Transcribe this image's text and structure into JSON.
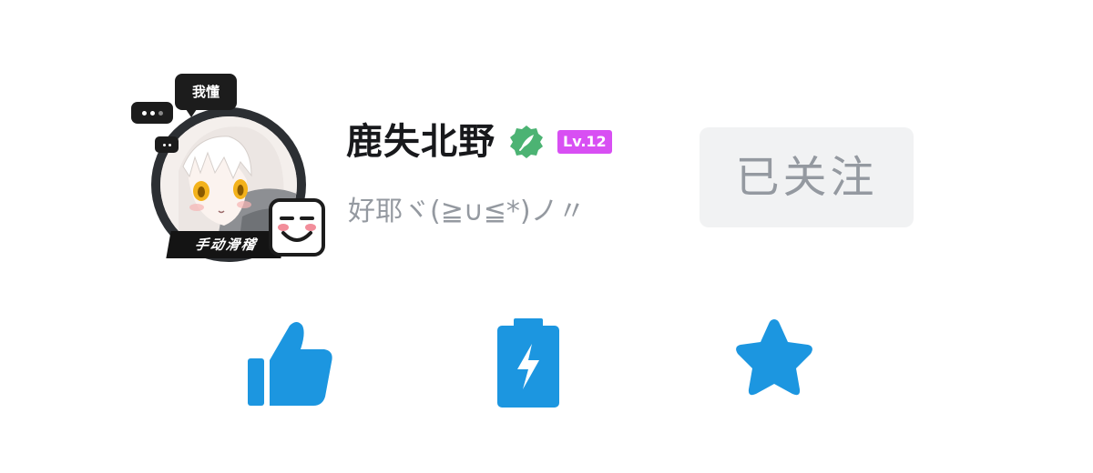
{
  "user": {
    "name": "鹿失北野",
    "level": "Lv.12",
    "signature": "好耶ヾ(≧∪≦*)ノ〃",
    "verified": true
  },
  "avatar": {
    "bubble_text": "我懂",
    "pendant_label": "手动滑稽"
  },
  "follow_button": {
    "label": "已关注"
  },
  "actions": {
    "like_icon": "thumbs-up-icon",
    "charge_icon": "battery-charge-icon",
    "favorite_icon": "star-icon"
  },
  "colors": {
    "action_blue": "#1c96e0",
    "level_badge": "#d84ff3",
    "verified_green": "#4cb373",
    "muted_text": "#9499a0",
    "follow_bg": "#f1f2f3"
  }
}
